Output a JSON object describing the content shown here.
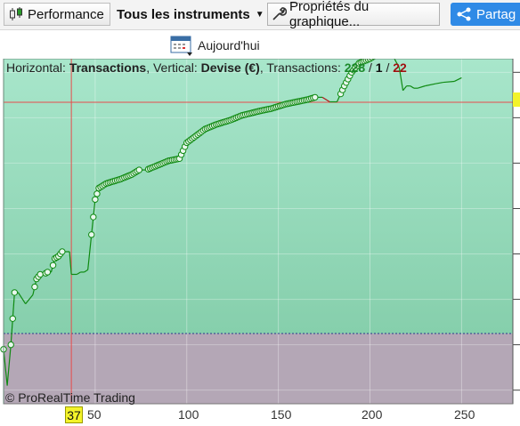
{
  "toolbar": {
    "performance_label": "Performance",
    "instruments_label": "Tous les instruments",
    "properties_label": "Propriétés du graphique...",
    "share_label": "Partag"
  },
  "subbar": {
    "today_label": "Aujourd'hui"
  },
  "chart_info": {
    "horizontal_prefix": "Horizontal: ",
    "horizontal_value": "Transactions",
    "vertical_prefix": ", Vertical: ",
    "vertical_value": "Devise (€)",
    "transactions_prefix": ", Transactions: ",
    "count_total": "228",
    "sep1": " / ",
    "count_neutral": "1",
    "sep2": " / ",
    "count_losing": "22"
  },
  "copyright": "© ProRealTime Trading",
  "x_axis": {
    "cursor_label": "37",
    "ticks": [
      "50",
      "100",
      "150",
      "200",
      "250"
    ]
  },
  "colors": {
    "gain_zone": "#9ee0c2",
    "loss_zone": "#b3a6b5",
    "curve": "#0f8a12",
    "drawdown": "#b11515",
    "cursor": "#e83a3a"
  },
  "chart_data": {
    "type": "line",
    "title": "",
    "xlabel": "Transactions",
    "ylabel": "Devise (€)",
    "xlim": [
      0,
      278
    ],
    "ylim": [
      -1.3,
      6.3
    ],
    "x": [
      0,
      2,
      4,
      6,
      8,
      12,
      16,
      18,
      20,
      22,
      24,
      26,
      28,
      30,
      32,
      36,
      37,
      40,
      42,
      44,
      46,
      50,
      52,
      56,
      60,
      64,
      70,
      74,
      78,
      84,
      90,
      96,
      100,
      110,
      116,
      124,
      130,
      140,
      146,
      154,
      160,
      166,
      170,
      174,
      178,
      182,
      186,
      190,
      194,
      200,
      204,
      208,
      212,
      216,
      218,
      220,
      222,
      224,
      226,
      230,
      236,
      240,
      246,
      250
    ],
    "values": [
      -0.1,
      -0.9,
      0.0,
      1.15,
      1.15,
      0.9,
      1.1,
      1.45,
      1.55,
      1.55,
      1.6,
      1.6,
      1.9,
      1.95,
      2.05,
      2.05,
      1.55,
      1.55,
      1.6,
      1.6,
      1.65,
      3.2,
      3.45,
      3.55,
      3.6,
      3.65,
      3.75,
      3.85,
      3.85,
      3.95,
      4.05,
      4.1,
      4.45,
      4.75,
      4.85,
      4.95,
      5.05,
      5.15,
      5.2,
      5.3,
      5.35,
      5.4,
      5.45,
      5.45,
      5.35,
      5.35,
      5.7,
      6.0,
      6.2,
      6.3,
      6.4,
      6.45,
      6.4,
      6.1,
      5.6,
      5.7,
      5.7,
      5.65,
      5.65,
      5.7,
      5.75,
      5.78,
      5.8,
      5.88
    ],
    "highlight_x": 37
  }
}
